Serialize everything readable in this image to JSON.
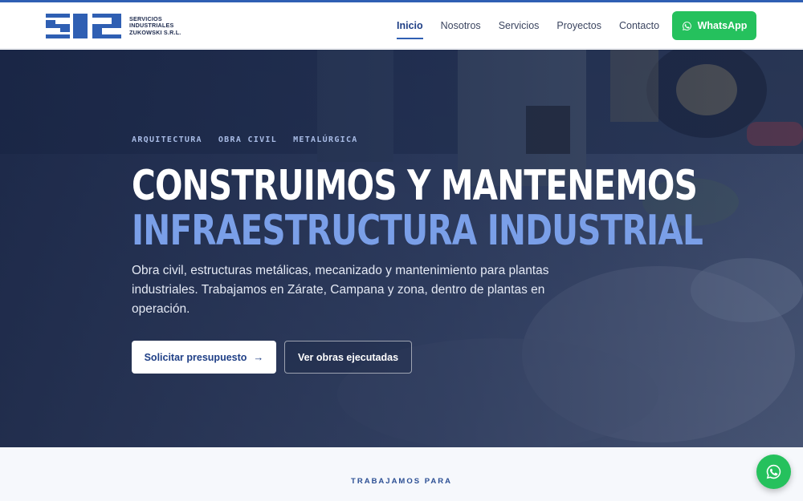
{
  "brand": {
    "line1": "SERVICIOS",
    "line2": "INDUSTRIALES",
    "line3": "ZUKOWSKI S.R.L.",
    "color": "#2f5fb3"
  },
  "nav": {
    "items": [
      {
        "label": "Inicio",
        "active": true
      },
      {
        "label": "Nosotros",
        "active": false
      },
      {
        "label": "Servicios",
        "active": false
      },
      {
        "label": "Proyectos",
        "active": false
      },
      {
        "label": "Contacto",
        "active": false
      }
    ],
    "whatsapp_label": "WhatsApp",
    "whatsapp_color": "#25c15d"
  },
  "hero": {
    "tags": [
      "ARQUITECTURA",
      "OBRA CIVIL",
      "METALÚRGICA"
    ],
    "title_line1": "CONSTRUIMOS Y MANTENEMOS",
    "title_line2": "INFRAESTRUCTURA INDUSTRIAL",
    "description": "Obra civil, estructuras metálicas, mecanizado y mantenimiento para plantas industriales. Trabajamos en Zárate, Campana y zona, dentro de plantas en operación.",
    "primary_cta": "Solicitar presupuesto",
    "primary_cta_icon": "arrow-right-icon",
    "secondary_cta": "Ver obras ejecutadas"
  },
  "clients": {
    "label": "TRABAJAMOS PARA"
  },
  "floating": {
    "icon": "whatsapp-icon"
  }
}
